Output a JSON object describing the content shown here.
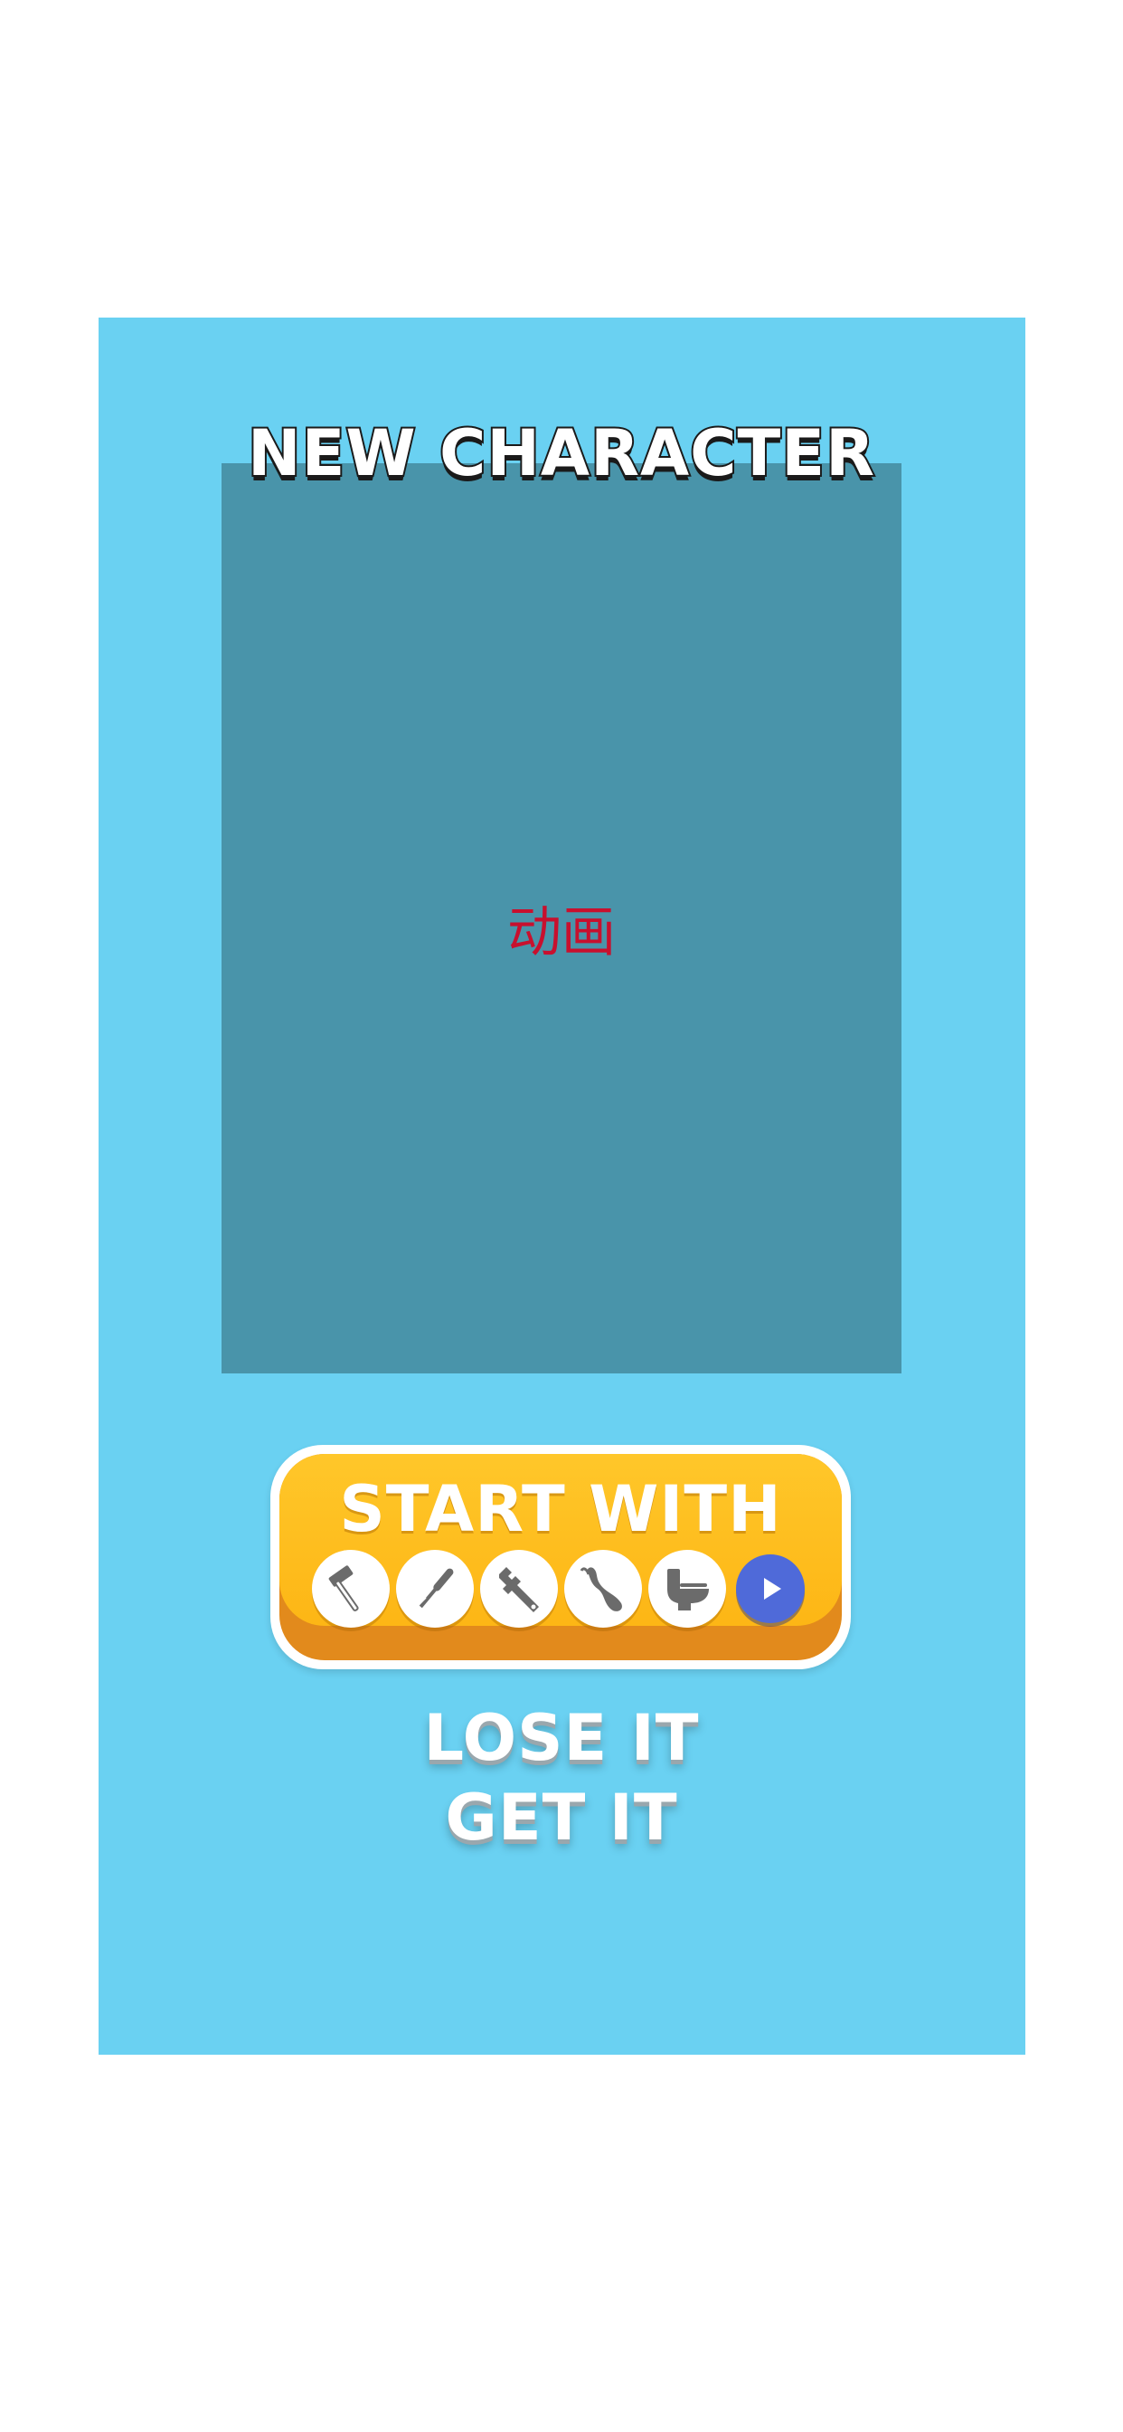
{
  "screen": {
    "title": "NEW CHARACTER",
    "preview_placeholder": "动画"
  },
  "start_button": {
    "label": "START WITH",
    "tools": [
      {
        "icon": "hammer-icon"
      },
      {
        "icon": "screwdriver-icon"
      },
      {
        "icon": "wrench-icon"
      },
      {
        "icon": "chili-pepper-icon"
      },
      {
        "icon": "toilet-icon"
      }
    ],
    "play_icon": "play-icon"
  },
  "tagline": {
    "line1": "LOSE IT",
    "line2": "GET IT"
  },
  "colors": {
    "page_bg": "#ffffff",
    "panel_bg": "#6ad1f2",
    "preview_bg": "#4994aa",
    "placeholder_text": "#c8102e",
    "button_yellow": "#fdb615",
    "button_orange": "#e28a1c",
    "play_blue": "#4f6ad9"
  }
}
